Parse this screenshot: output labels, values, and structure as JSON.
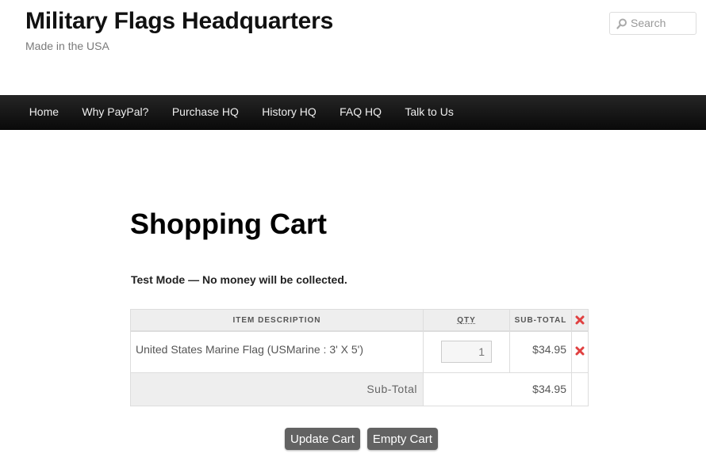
{
  "header": {
    "site_title": "Military Flags Headquarters",
    "tagline": "Made in the USA",
    "search_placeholder": "Search"
  },
  "nav": {
    "items": [
      {
        "label": "Home"
      },
      {
        "label": "Why PayPal?"
      },
      {
        "label": "Purchase HQ"
      },
      {
        "label": "History HQ"
      },
      {
        "label": "FAQ HQ"
      },
      {
        "label": "Talk to Us"
      }
    ]
  },
  "main": {
    "page_title": "Shopping Cart",
    "test_mode_notice": "Test Mode — No money will be collected."
  },
  "cart": {
    "columns": {
      "description": "Item Description",
      "qty": "Qty",
      "subtotal": "Sub-Total"
    },
    "items": [
      {
        "description": "United States Marine Flag (USMarine : 3' X 5')",
        "qty": "1",
        "subtotal": "$34.95"
      }
    ],
    "subtotal_label": "Sub-Total",
    "subtotal_value": "$34.95"
  },
  "buttons": {
    "update_label": "Update Cart",
    "empty_label": "Empty Cart"
  },
  "colors": {
    "remove_icon": "#e04040",
    "nav_background": "#111111",
    "button_background": "#626262"
  },
  "icons": {
    "search": "search-icon",
    "remove": "remove-x-icon"
  }
}
